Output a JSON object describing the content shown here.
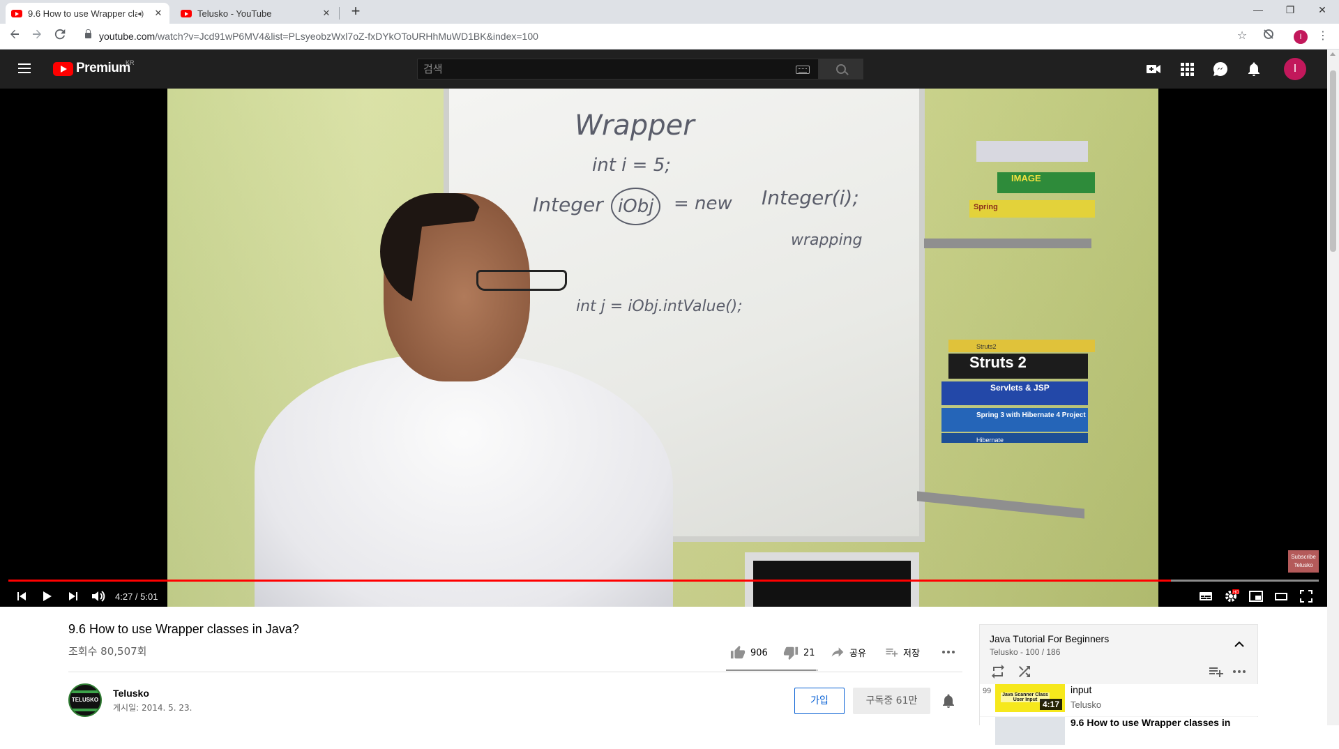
{
  "browser": {
    "tabs": [
      {
        "title": "9.6 How to use Wrapper cla",
        "active": true,
        "audio": true
      },
      {
        "title": "Telusko - YouTube",
        "active": false,
        "audio": false
      }
    ],
    "url_host": "youtube.com",
    "url_path": "/watch?v=Jcd91wP6MV4&list=PLsyeobzWxl7oZ-fxDYkOToURHhMuWD1BK&index=100",
    "profile_initial": "I"
  },
  "masthead": {
    "brand": "Premium",
    "region": "KR",
    "search_placeholder": "검색",
    "avatar_initial": "I"
  },
  "player": {
    "current_time": "4:27",
    "duration": "5:01",
    "time_display": "4:27 / 5:01",
    "progress_fraction": 0.887,
    "buffered_fraction": 1.0,
    "subscribe_badge": "Subscribe Telusko",
    "whiteboard": {
      "line1": "Wrapper",
      "line2": "int  i = 5;",
      "line3a": "Integer",
      "line3b": "iObj",
      "line3c": "= new",
      "line3d": "Integer(i);",
      "line4": "wrapping",
      "line5": "int  j = iObj.intValue();"
    },
    "shelf_book_labels": [
      "Spring",
      "IMAGE",
      "Struts2",
      "Struts 2",
      "Servlets & JSP",
      "Spring 3 with Hibernate 4 Project",
      "Hibernate"
    ]
  },
  "video": {
    "title": "9.6 How to use Wrapper classes in Java?",
    "views": "조회수 80,507회",
    "likes": "906",
    "dislikes": "21",
    "share_label": "공유",
    "save_label": "저장",
    "like_ratio": 0.977
  },
  "channel": {
    "name": "Telusko",
    "avatar_text": "TELUSKO",
    "published": "게시일: 2014. 5. 23.",
    "join_label": "가입",
    "subscribe_label": "구독중 61만"
  },
  "playlist": {
    "title": "Java Tutorial For Beginners",
    "subtitle": "Telusko - 100 / 186",
    "items": [
      {
        "index": "99",
        "title": "input",
        "channel": "Telusko",
        "duration": "4:17",
        "thumb_caption": "Java Scanner Class User Input"
      },
      {
        "index": "",
        "title": "9.6 How to use Wrapper classes in",
        "channel": "",
        "duration": "",
        "thumb_caption": ""
      }
    ]
  },
  "colors": {
    "brand_red": "#ff0000",
    "accent_blue": "#065fd4",
    "masthead_bg": "#202020",
    "avatar_pink": "#c2185b"
  }
}
